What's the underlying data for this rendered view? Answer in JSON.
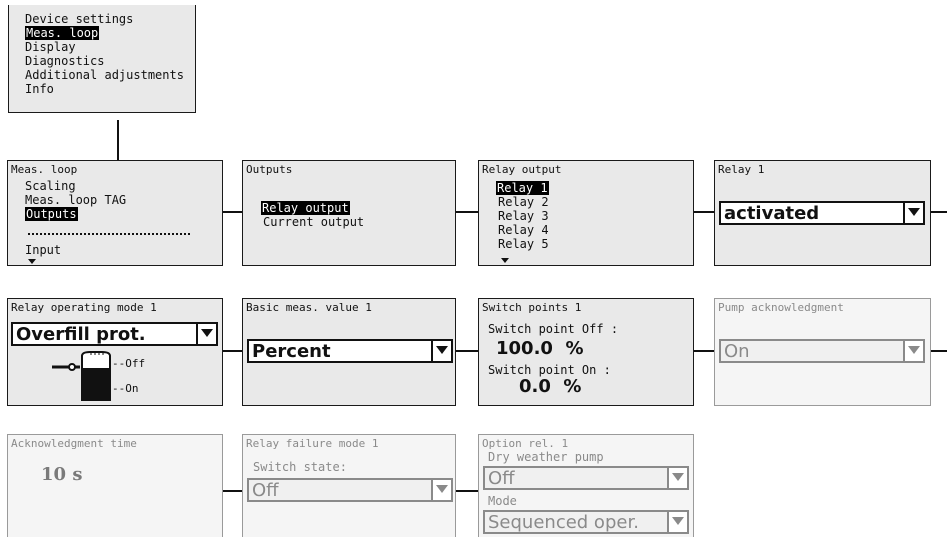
{
  "main_menu": {
    "items": [
      "Device settings",
      "Meas. loop",
      "Display",
      "Diagnostics",
      "Additional adjustments",
      "Info"
    ]
  },
  "meas_loop": {
    "title": "Meas. loop",
    "items": [
      "Scaling",
      "Meas. loop TAG",
      "Outputs"
    ],
    "extra": "Input"
  },
  "outputs": {
    "title": "Outputs",
    "items": [
      "Relay output",
      "Current output"
    ]
  },
  "relay_output": {
    "title": "Relay output",
    "items": [
      "Relay 1",
      "Relay 2",
      "Relay 3",
      "Relay 4",
      "Relay 5"
    ]
  },
  "relay1": {
    "title": "Relay 1",
    "value": "activated"
  },
  "relay_mode": {
    "title": "Relay operating mode 1",
    "value": "Overfill prot.",
    "off_label": "--Off",
    "on_label": "--On"
  },
  "basic_meas": {
    "title": "Basic meas. value 1",
    "value": "Percent"
  },
  "switch_points": {
    "title": "Switch points 1",
    "off_label": "Switch point Off :",
    "off_value": "100.0  %",
    "on_label": "Switch point On :",
    "on_value": "0.0  %"
  },
  "pump_ack": {
    "title": "Pump acknowledgment",
    "value": "On"
  },
  "ack_time": {
    "title": "Acknowledgment time",
    "value": "10 s"
  },
  "relay_failure": {
    "title": "Relay failure mode 1",
    "label": "Switch state:",
    "value": "Off"
  },
  "option_rel": {
    "title": "Option rel. 1",
    "label1": "Dry weather pump",
    "value1": "Off",
    "label2": "Mode",
    "value2": "Sequenced oper."
  }
}
